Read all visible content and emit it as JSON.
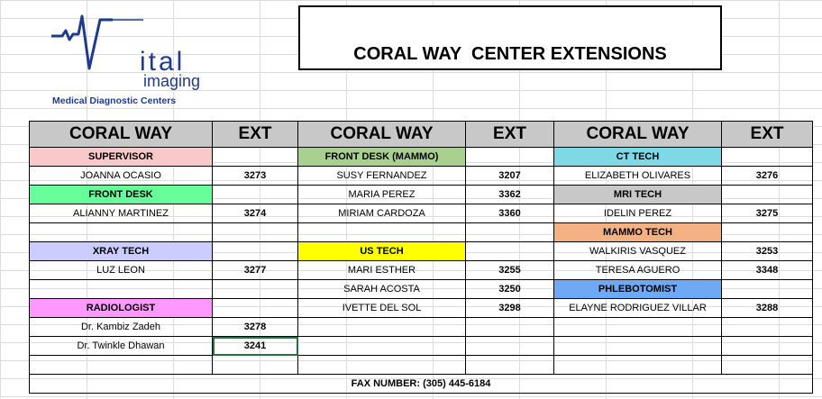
{
  "logo": {
    "brand_letters": "ital",
    "brand_word": "imaging",
    "tagline": "Medical Diagnostic Centers"
  },
  "title": "CORAL WAY  CENTER EXTENSIONS",
  "headers": {
    "col1": "CORAL  WAY",
    "col2": "EXT",
    "col3": "CORAL  WAY",
    "col4": "EXT",
    "col5": "CORAL  WAY",
    "col6": "EXT"
  },
  "rows": [
    [
      "SUPERVISOR",
      "",
      "FRONT DESK (MAMMO)",
      "",
      "CT TECH",
      ""
    ],
    [
      "JOANNA OCASIO",
      "3273",
      "SUSY FERNANDEZ",
      "3207",
      "ELIZABETH OLIVARES",
      "3276"
    ],
    [
      "FRONT DESK",
      "",
      "MARIA PEREZ",
      "3362",
      "MRI TECH",
      ""
    ],
    [
      "ALIANNY MARTINEZ",
      "3274",
      "MIRIAM CARDOZA",
      "3360",
      "IDELIN PEREZ",
      "3275"
    ],
    [
      "",
      "",
      "",
      "",
      "MAMMO TECH",
      ""
    ],
    [
      "XRAY TECH",
      "",
      "US TECH",
      "",
      "WALKIRIS VASQUEZ",
      "3253"
    ],
    [
      "LUZ LEON",
      "3277",
      "MARI ESTHER",
      "3255",
      "TERESA AGUERO",
      "3348"
    ],
    [
      "",
      "",
      "SARAH ACOSTA",
      "3250",
      "PHLEBOTOMIST",
      ""
    ],
    [
      "RADIOLOGIST",
      "",
      "IVETTE DEL SOL",
      "3298",
      "ELAYNE RODRIGUEZ VILLAR",
      "3288"
    ],
    [
      "Dr. Kambiz Zadeh",
      "3278",
      "",
      "",
      "",
      ""
    ],
    [
      "Dr. Twinkle Dhawan",
      "3241",
      "",
      "",
      "",
      ""
    ],
    [
      "",
      "",
      "",
      "",
      "",
      ""
    ]
  ],
  "fax": "FAX NUMBER: (305) 445-6184",
  "colors": {
    "supervisor": "#f9c8c8",
    "front_desk": "#66ff99",
    "xray_tech": "#ccccff",
    "radiologist": "#ff99ff",
    "front_desk_mammo": "#a9d08e",
    "us_tech": "#ffff00",
    "ct_tech": "#7fd8e6",
    "mri_tech": "#c8c8c8",
    "mammo_tech": "#f4b183",
    "phlebotomist": "#6fa8f5",
    "header": "#c8c8c8"
  }
}
